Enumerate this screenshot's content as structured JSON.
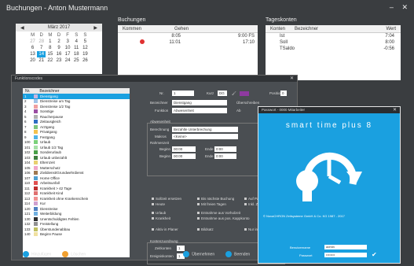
{
  "window": {
    "title": "Buchungen - Anton Mustermann"
  },
  "calendar": {
    "month_label": "März 2017",
    "weekdays": [
      "M",
      "D",
      "M",
      "D",
      "F",
      "S",
      "S"
    ],
    "weeks": [
      [
        "27",
        "28",
        "1",
        "2",
        "3",
        "4",
        "5"
      ],
      [
        "6",
        "7",
        "8",
        "9",
        "10",
        "11",
        "12"
      ],
      [
        "13",
        "14",
        "15",
        "16",
        "17",
        "18",
        "19"
      ],
      [
        "20",
        "21",
        "22",
        "23",
        "24",
        "25",
        "26"
      ]
    ],
    "selected": "14"
  },
  "buchungen": {
    "title": "Buchungen",
    "col_kommen": "Kommen",
    "col_gehen": "Gehen",
    "rows": [
      {
        "kommen": "8:05",
        "gehen": "9:00 FS"
      },
      {
        "kommen": "11:01",
        "gehen": "17:10"
      }
    ]
  },
  "tageskonten": {
    "title": "Tageskonten",
    "col_konten": "Konten",
    "col_bezeichner": "Bezeichner",
    "col_wert": "Wert",
    "rows": [
      {
        "name": "Ist",
        "value": "7:04"
      },
      {
        "name": "Soll",
        "value": "8:00"
      },
      {
        "name": "TSaldo",
        "value": "-0:56"
      }
    ]
  },
  "funktionscodes": {
    "title": "Funktionscodes",
    "col_nr": "Nr.",
    "col_bezeichner": "Bezeichner",
    "rows": [
      {
        "nr": "1",
        "label": "Dienstgang",
        "color": "#c8b6e0"
      },
      {
        "nr": "2",
        "label": "Dienstreise um Tag",
        "color": "#a0c4e8"
      },
      {
        "nr": "3",
        "label": "Dienstreise 1/2 Tag",
        "color": "#f0a0a0"
      },
      {
        "nr": "4",
        "label": "Sonstige",
        "color": "#9b4ea3"
      },
      {
        "nr": "5",
        "label": "Raucherpause",
        "color": "#b0b0b0"
      },
      {
        "nr": "6",
        "label": "Zeitausgleich",
        "color": "#2f6ec2"
      },
      {
        "nr": "7",
        "label": "Arztgang",
        "color": "#7cc47c"
      },
      {
        "nr": "8",
        "label": "Privatgang",
        "color": "#f2c14e"
      },
      {
        "nr": "9",
        "label": "Festgang",
        "color": "#4fb4e8"
      },
      {
        "nr": "100",
        "label": "Urlaub",
        "color": "#7ad17a"
      },
      {
        "nr": "101",
        "label": "Urlaub 1/2 Tag",
        "color": "#a5e0a5"
      },
      {
        "nr": "102",
        "label": "Sonderurlaub",
        "color": "#48a048"
      },
      {
        "nr": "103",
        "label": "Urlaub unbezahlt",
        "color": "#3e7f3e"
      },
      {
        "nr": "104",
        "label": "Elternzeit",
        "color": "#e8d070"
      },
      {
        "nr": "105",
        "label": "Mutterschutz",
        "color": "#f0a4c8"
      },
      {
        "nr": "106",
        "label": "Zivildienst/Grundwehrdienst",
        "color": "#a07850"
      },
      {
        "nr": "107",
        "label": "Home Office",
        "color": "#50a0d0"
      },
      {
        "nr": "110",
        "label": "Arbeitsunfall",
        "color": "#e05050"
      },
      {
        "nr": "111",
        "label": "Krankheit > 42 Tage",
        "color": "#c03030"
      },
      {
        "nr": "112",
        "label": "Krankheit Kind",
        "color": "#e07070"
      },
      {
        "nr": "113",
        "label": "Krankheit ohne Krankenschein",
        "color": "#f09090"
      },
      {
        "nr": "114",
        "label": "Kur",
        "color": "#d0a0d0"
      },
      {
        "nr": "120",
        "label": "Dienstreise",
        "color": "#5080c0"
      },
      {
        "nr": "121",
        "label": "Weiterbildung",
        "color": "#70b0e0"
      },
      {
        "nr": "130",
        "label": "Unentschuldigtes Fehlen",
        "color": "#303030"
      },
      {
        "nr": "132",
        "label": "Freistellung",
        "color": "#909090"
      },
      {
        "nr": "133",
        "label": "Überstundenabbau",
        "color": "#c0c060"
      },
      {
        "nr": "140",
        "label": "Beginn Pause",
        "color": "#f0e0a0"
      }
    ],
    "form": {
      "nr_label": "Nr.",
      "nr_value": "1",
      "kurz_label": "Kurz",
      "kurz_value": "DG",
      "bez_label": "Bezeichner",
      "bez_value": "Dienstgang",
      "funk_label": "Funktion",
      "funk_value": "Abwesenheit",
      "ueber_label": "Überschreiben",
      "ab_label": "Ab",
      "position_label": "Position",
      "position_value": "0",
      "abwesenheit_label": "Abwesenheit",
      "berech_label": "Berechnung",
      "berech_value": "Bezahlte Unterbrechung",
      "makro_label": "Makros",
      "makro_value": "<Keine>",
      "rahmen_label": "Rahmenzeit",
      "beginn_label": "Beginn",
      "beginn_value": "00:00",
      "ende_label": "Ende",
      "ende_value": "0:00",
      "beginn2_value": "00:00",
      "ende2_value": "0:00",
      "zeit_label": "Zeit",
      "checks": [
        "Sollzeit ersetzen",
        "Bis nächste Buchung",
        "Auf Pausen",
        "Heute",
        "Mit freien Tagen",
        "Inkl. Zeiten",
        "Urlaub",
        "Entnahme aus Vorholzeit",
        "Krankheit",
        "Entnahme aus pos. Kappkonto",
        "Aktiv in Planer",
        "Bildsatz",
        "Nur in Kontrolle"
      ],
      "kontierung_label": "Kontenzuordnung",
      "zeitkonten_label": "Zeitkonten",
      "zeitkonten_value": "1",
      "ereigniskonten_label": "Ereigniskonten",
      "ereigniskonten_value": "1"
    },
    "buttons": {
      "add": "Hinzufügen",
      "delete": "Löschen",
      "apply": "Übernehmen",
      "close": "Beenden"
    }
  },
  "splash": {
    "title": "Passwort - 0000 Mitarbeiter",
    "product": "smart time plus 8",
    "copyright": "© NovaCHRON Zeitsysteme GmbH & Co. KG 1987 - 2017",
    "user_label": "Benutzername",
    "user_value": "admin",
    "pw_label": "Passwort",
    "pw_value": "••••••••"
  }
}
